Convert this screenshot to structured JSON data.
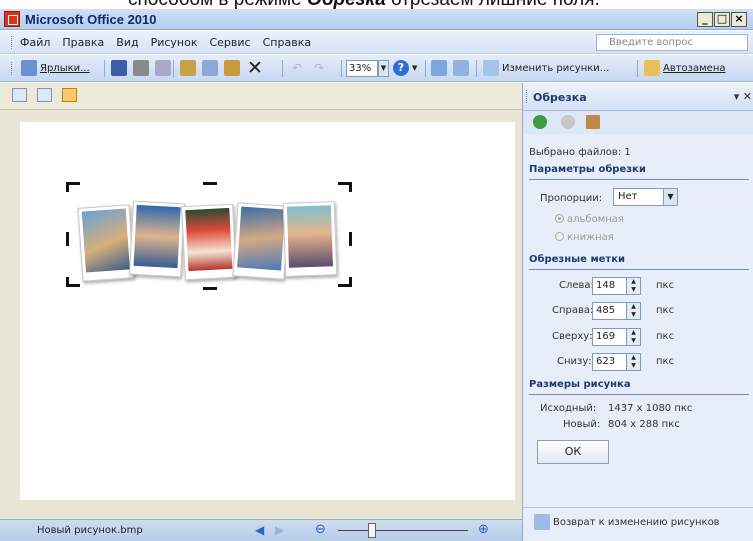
{
  "caption": {
    "text": "способом в режиме ",
    "emph": "Обрезка",
    "tail": " отрезаем лишние поля."
  },
  "window": {
    "title": "Microsoft Office 2010",
    "controls": [
      "_",
      "□",
      "×"
    ]
  },
  "menu": {
    "items": [
      "Файл",
      "Правка",
      "Вид",
      "Рисунок",
      "Сервис",
      "Справка"
    ],
    "ask_placeholder": "Введите вопрос"
  },
  "toolbar": {
    "shortcuts": "Ярлыки...",
    "zoom": "33%",
    "edit_pictures": "Изменить рисунки...",
    "autocorrect": "Автозамена"
  },
  "status": {
    "filename": "Новый рисунок.bmp"
  },
  "panel": {
    "title": "Обрезка",
    "selected": "Выбрано файлов: 1",
    "crop_params": "Параметры обрезки",
    "aspect_label": "Пропорции:",
    "aspect_value": "Нет",
    "landscape": "альбомная",
    "portrait": "книжная",
    "crop_marks": "Обрезные метки",
    "left_label": "Слева:",
    "left_value": "148",
    "right_label": "Справа:",
    "right_value": "485",
    "top_label": "Сверху:",
    "top_value": "169",
    "bottom_label": "Снизу:",
    "bottom_value": "623",
    "unit": "пкс",
    "size_title": "Размеры рисунка",
    "original_label": "Исходный:",
    "original_value": "1437 x 1080 пкс",
    "new_label": "Новый:",
    "new_value": "804 x 288 пкс",
    "ok": "ОК",
    "back": "Возврат к изменению рисунков"
  },
  "colors": {
    "accent": "#1f3a70",
    "titlebar": "#b6cdee"
  }
}
